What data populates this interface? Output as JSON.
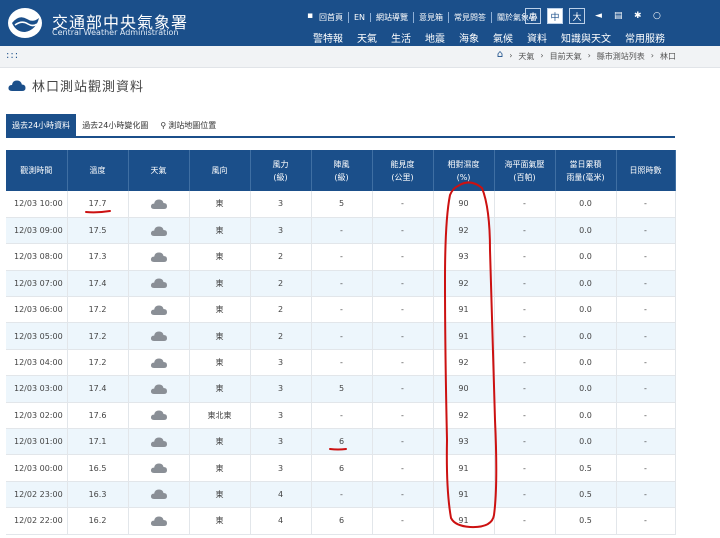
{
  "header": {
    "logo_zh": "交通部中央氣象署",
    "logo_en": "Central Weather Administration",
    "top_links": [
      "回首頁",
      "EN",
      "網站導覽",
      "意見箱",
      "常見問答",
      "關於氣象署"
    ],
    "size_buttons": [
      "小",
      "中",
      "大"
    ],
    "active_size": "中",
    "main_nav": [
      "警特報",
      "天氣",
      "生活",
      "地震",
      "海象",
      "氣候",
      "資料",
      "知識與天文",
      "常用服務"
    ]
  },
  "breadcrumb": {
    "menu_glyph": ":::",
    "items": [
      "天氣",
      "目前天氣",
      "縣市測站列表",
      "林口"
    ]
  },
  "page": {
    "title": "林口測站觀測資料"
  },
  "tabs": [
    {
      "label": "過去24小時資料",
      "active": true
    },
    {
      "label": "過去24小時變化圖",
      "active": false
    },
    {
      "label": "測站地圖位置",
      "active": false
    }
  ],
  "table": {
    "headers": [
      {
        "line1": "觀測時間",
        "line2": ""
      },
      {
        "line1": "溫度",
        "line2": ""
      },
      {
        "line1": "天氣",
        "line2": ""
      },
      {
        "line1": "風向",
        "line2": ""
      },
      {
        "line1": "風力",
        "line2": "(級)"
      },
      {
        "line1": "陣風",
        "line2": "(級)"
      },
      {
        "line1": "能見度",
        "line2": "(公里)"
      },
      {
        "line1": "相對濕度",
        "line2": "(%)"
      },
      {
        "line1": "海平面氣壓",
        "line2": "(百帕)"
      },
      {
        "line1": "當日累積",
        "line2": "雨量(毫米)"
      },
      {
        "line1": "日照時數",
        "line2": ""
      }
    ],
    "rows": [
      {
        "time": "12/03 10:00",
        "temp": "17.7",
        "weather": "cloudy-icon",
        "wind_dir": "東",
        "wind": "3",
        "gust": "5",
        "vis": "-",
        "rh": "90",
        "pressure": "-",
        "rain": "0.0",
        "sun": "-"
      },
      {
        "time": "12/03 09:00",
        "temp": "17.5",
        "weather": "cloudy-icon",
        "wind_dir": "東",
        "wind": "3",
        "gust": "-",
        "vis": "-",
        "rh": "92",
        "pressure": "-",
        "rain": "0.0",
        "sun": "-"
      },
      {
        "time": "12/03 08:00",
        "temp": "17.3",
        "weather": "cloudy-icon",
        "wind_dir": "東",
        "wind": "2",
        "gust": "-",
        "vis": "-",
        "rh": "93",
        "pressure": "-",
        "rain": "0.0",
        "sun": "-"
      },
      {
        "time": "12/03 07:00",
        "temp": "17.4",
        "weather": "cloudy-icon",
        "wind_dir": "東",
        "wind": "2",
        "gust": "-",
        "vis": "-",
        "rh": "92",
        "pressure": "-",
        "rain": "0.0",
        "sun": "-"
      },
      {
        "time": "12/03 06:00",
        "temp": "17.2",
        "weather": "cloudy-icon",
        "wind_dir": "東",
        "wind": "2",
        "gust": "-",
        "vis": "-",
        "rh": "91",
        "pressure": "-",
        "rain": "0.0",
        "sun": "-"
      },
      {
        "time": "12/03 05:00",
        "temp": "17.2",
        "weather": "cloudy-icon",
        "wind_dir": "東",
        "wind": "2",
        "gust": "-",
        "vis": "-",
        "rh": "91",
        "pressure": "-",
        "rain": "0.0",
        "sun": "-"
      },
      {
        "time": "12/03 04:00",
        "temp": "17.2",
        "weather": "cloudy-icon",
        "wind_dir": "東",
        "wind": "3",
        "gust": "-",
        "vis": "-",
        "rh": "92",
        "pressure": "-",
        "rain": "0.0",
        "sun": "-"
      },
      {
        "time": "12/03 03:00",
        "temp": "17.4",
        "weather": "cloudy-icon",
        "wind_dir": "東",
        "wind": "3",
        "gust": "5",
        "vis": "-",
        "rh": "90",
        "pressure": "-",
        "rain": "0.0",
        "sun": "-"
      },
      {
        "time": "12/03 02:00",
        "temp": "17.6",
        "weather": "cloudy-icon",
        "wind_dir": "東北東",
        "wind": "3",
        "gust": "-",
        "vis": "-",
        "rh": "92",
        "pressure": "-",
        "rain": "0.0",
        "sun": "-"
      },
      {
        "time": "12/03 01:00",
        "temp": "17.1",
        "weather": "cloudy-icon",
        "wind_dir": "東",
        "wind": "3",
        "gust": "6",
        "vis": "-",
        "rh": "93",
        "pressure": "-",
        "rain": "0.0",
        "sun": "-"
      },
      {
        "time": "12/03 00:00",
        "temp": "16.5",
        "weather": "cloudy-icon",
        "wind_dir": "東",
        "wind": "3",
        "gust": "6",
        "vis": "-",
        "rh": "91",
        "pressure": "-",
        "rain": "0.5",
        "sun": "-"
      },
      {
        "time": "12/02 23:00",
        "temp": "16.3",
        "weather": "cloudy-icon",
        "wind_dir": "東",
        "wind": "4",
        "gust": "-",
        "vis": "-",
        "rh": "91",
        "pressure": "-",
        "rain": "0.5",
        "sun": "-"
      },
      {
        "time": "12/02 22:00",
        "temp": "16.2",
        "weather": "cloudy-icon",
        "wind_dir": "東",
        "wind": "4",
        "gust": "6",
        "vis": "-",
        "rh": "91",
        "pressure": "-",
        "rain": "0.5",
        "sun": "-"
      }
    ]
  },
  "colors": {
    "brand": "#1b4f8a",
    "row_alt": "#edf6fc",
    "annotation": "#cc1111"
  }
}
